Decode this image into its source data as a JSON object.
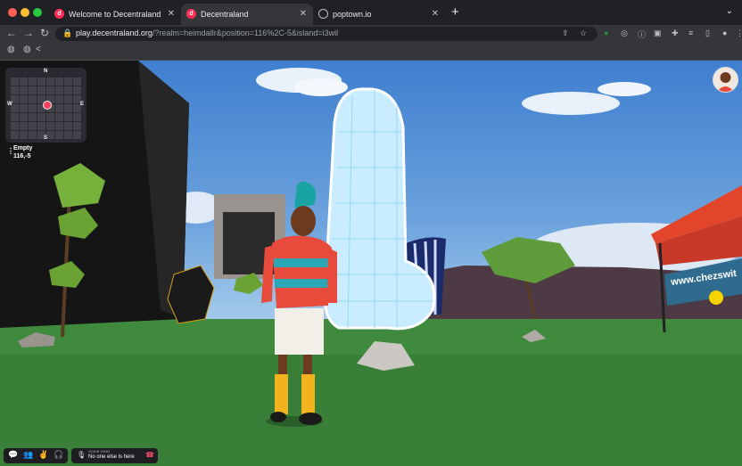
{
  "browser": {
    "tabs": [
      {
        "title": "Welcome to Decentraland",
        "active": false
      },
      {
        "title": "Decentraland",
        "active": true
      },
      {
        "title": "poptown.io",
        "active": false
      }
    ],
    "new_tab": "+",
    "tab_menu": "⌄",
    "url_host": "play.decentraland.org",
    "url_rest": "/?realm=heimdallr&position=116%2C-5&island=i3wil",
    "icons": [
      "back-icon",
      "forward-icon",
      "reload-icon",
      "lock-icon",
      "share-icon",
      "star-icon",
      "extensions-icon",
      "profile-icon",
      "menu-icon"
    ]
  },
  "game": {
    "minimap": {
      "north": "N",
      "south": "S",
      "west": "W",
      "east": "E"
    },
    "location": {
      "name": "Empty",
      "coords": "116,-5"
    },
    "voice": {
      "label": "VOICE CHAT",
      "status": "No one else is here"
    },
    "banner": "www.chezswit"
  },
  "colors": {
    "accent": "#ff2d55",
    "sky": "#6da3dd",
    "grass": "#3f8a3c"
  }
}
